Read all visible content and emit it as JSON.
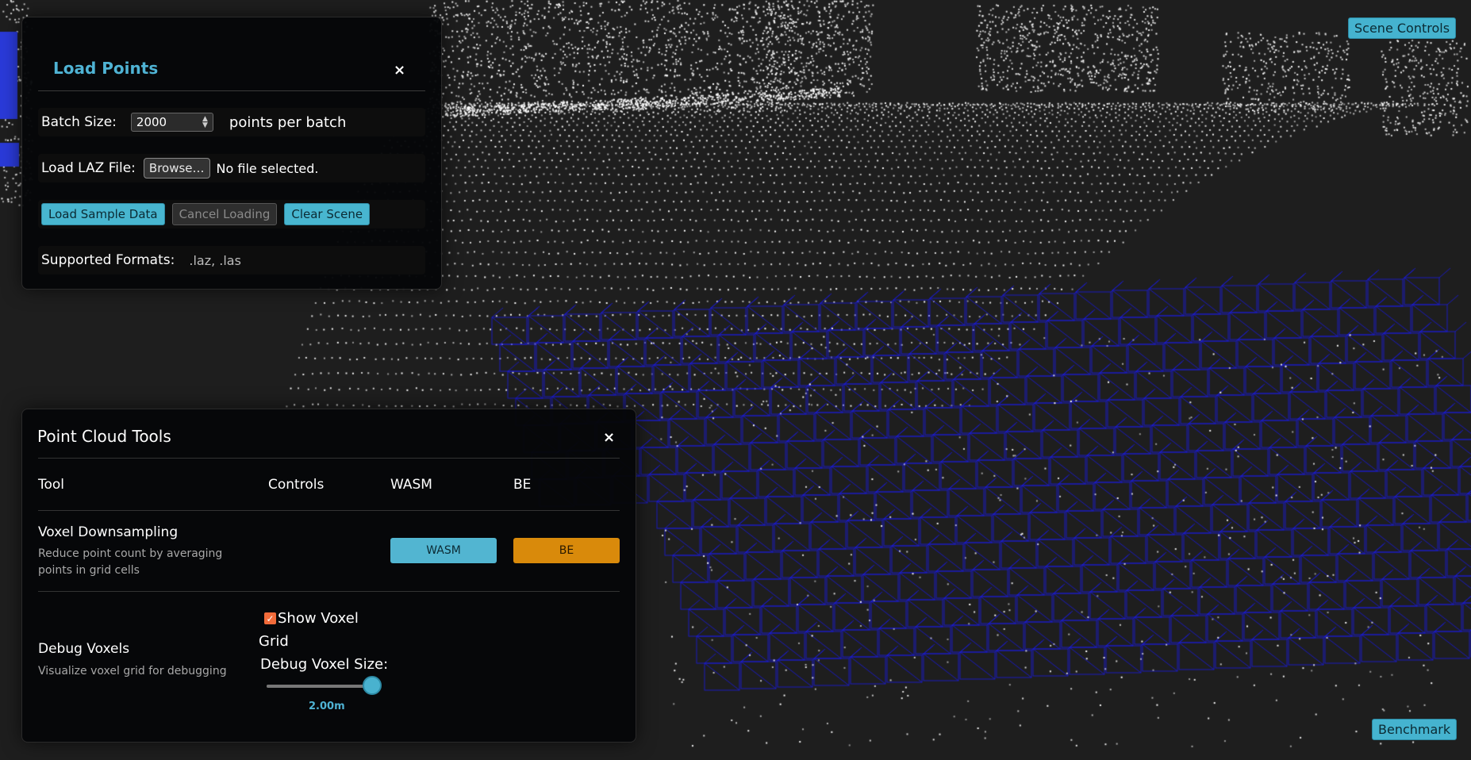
{
  "viewport": {
    "background_color": "#1e1e1e",
    "point_color": "#ffffff",
    "voxel_grid_color": "#1a1ad8"
  },
  "load_points": {
    "title": "Load Points",
    "close_symbol": "×",
    "batch_size_label": "Batch Size:",
    "batch_size_value": "2000",
    "batch_size_unit": "points per batch",
    "load_laz_label": "Load LAZ File:",
    "browse_label": "Browse…",
    "file_status": "No file selected.",
    "load_sample_label": "Load Sample Data",
    "cancel_loading_label": "Cancel Loading",
    "clear_scene_label": "Clear Scene",
    "supported_formats_label": "Supported Formats:",
    "supported_formats_value": ".laz, .las"
  },
  "tools": {
    "title": "Point Cloud Tools",
    "close_symbol": "×",
    "columns": [
      "Tool",
      "Controls",
      "WASM",
      "BE"
    ],
    "voxel_downsampling": {
      "name": "Voxel Downsampling",
      "description": "Reduce point count by averaging points in grid cells",
      "wasm_label": "WASM",
      "be_label": "BE"
    },
    "debug_voxels": {
      "name": "Debug Voxels",
      "description": "Visualize voxel grid for debugging",
      "show_grid_label": "Show Voxel Grid",
      "show_grid_checked": true,
      "size_label": "Debug Voxel Size:",
      "size_value": "2.00m",
      "size_fraction": 0.95
    }
  },
  "scene_controls_label": "Scene Controls",
  "benchmark_label": "Benchmark"
}
